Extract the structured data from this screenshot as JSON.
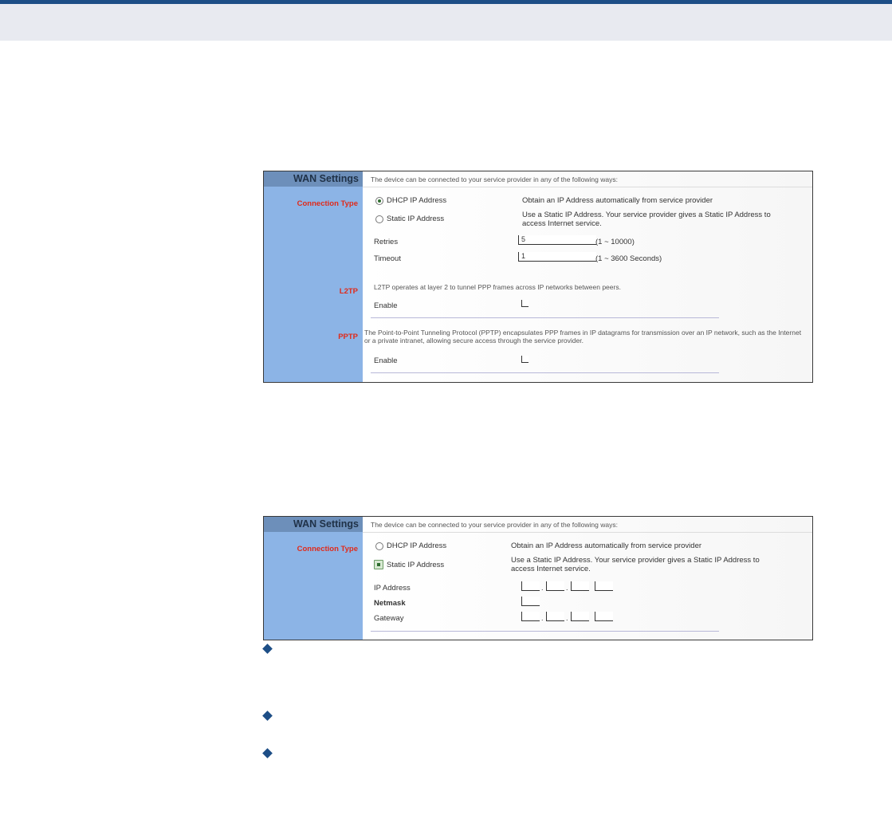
{
  "shot1": {
    "sidebar_title": "WAN Settings",
    "intro": "The device can be connected to your service provider in any of the following ways:",
    "connection_type_label": "Connection Type",
    "dhcp_label": "DHCP IP Address",
    "dhcp_desc": "Obtain an IP Address automatically from service provider",
    "static_label": "Static IP Address",
    "static_desc_line1": "Use a Static IP Address. Your service provider gives a Static IP Address to",
    "static_desc_line2": "access Internet service.",
    "retries_label": "Retries",
    "retries_value": "5",
    "retries_range": "(1 ~ 10000)",
    "timeout_label": "Timeout",
    "timeout_value": "1",
    "timeout_range": "(1 ~ 3600 Seconds)",
    "l2tp_label": "L2TP",
    "l2tp_desc": "L2TP operates at layer 2 to tunnel PPP frames across IP networks between peers.",
    "l2tp_enable_label": "Enable",
    "pptp_label": "PPTP",
    "pptp_desc_line1": "The Point-to-Point Tunneling Protocol (PPTP) encapsulates PPP frames in IP datagrams for transmission over an IP network, such as the Internet",
    "pptp_desc_line2": "or a private intranet, allowing secure access through the service provider.",
    "pptp_enable_label": "Enable"
  },
  "shot2": {
    "sidebar_title": "WAN Settings",
    "intro": "The device can be connected to your service provider in any of the following ways:",
    "connection_type_label": "Connection Type",
    "dhcp_label": "DHCP IP Address",
    "dhcp_desc": "Obtain an IP Address automatically from service provider",
    "static_label": "Static IP Address",
    "static_desc_line1": "Use a Static IP Address. Your service provider gives a Static IP Address to",
    "static_desc_line2": "access Internet service.",
    "ip_label": "IP Address",
    "netmask_label": "Netmask",
    "gateway_label": "Gateway"
  },
  "colors": {
    "brand": "#1d4e86",
    "sidebar": "#8cb4e6",
    "sidebar_header": "#6d8fba",
    "label_red": "#e02a1a"
  }
}
